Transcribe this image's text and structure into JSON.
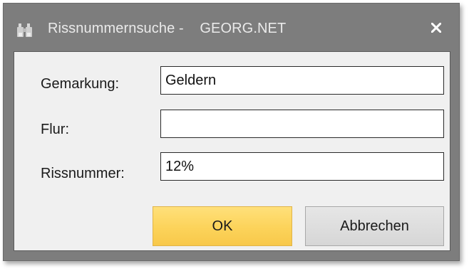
{
  "window": {
    "title": "Rissnummernsuche -    GEORG.NET",
    "icon": "binoculars-icon",
    "close_icon": "close-icon"
  },
  "form": {
    "fields": [
      {
        "label": "Gemarkung:",
        "value": "Geldern"
      },
      {
        "label": "Flur:",
        "value": ""
      },
      {
        "label": "Rissnummer:",
        "value": "12%"
      }
    ]
  },
  "buttons": {
    "ok_label": "OK",
    "cancel_label": "Abbrechen"
  },
  "colors": {
    "window_chrome": "#7d7d7d",
    "content_bg": "#f0f0f0",
    "ok_button": "#fcd35a",
    "cancel_button": "#dcdcdc"
  }
}
